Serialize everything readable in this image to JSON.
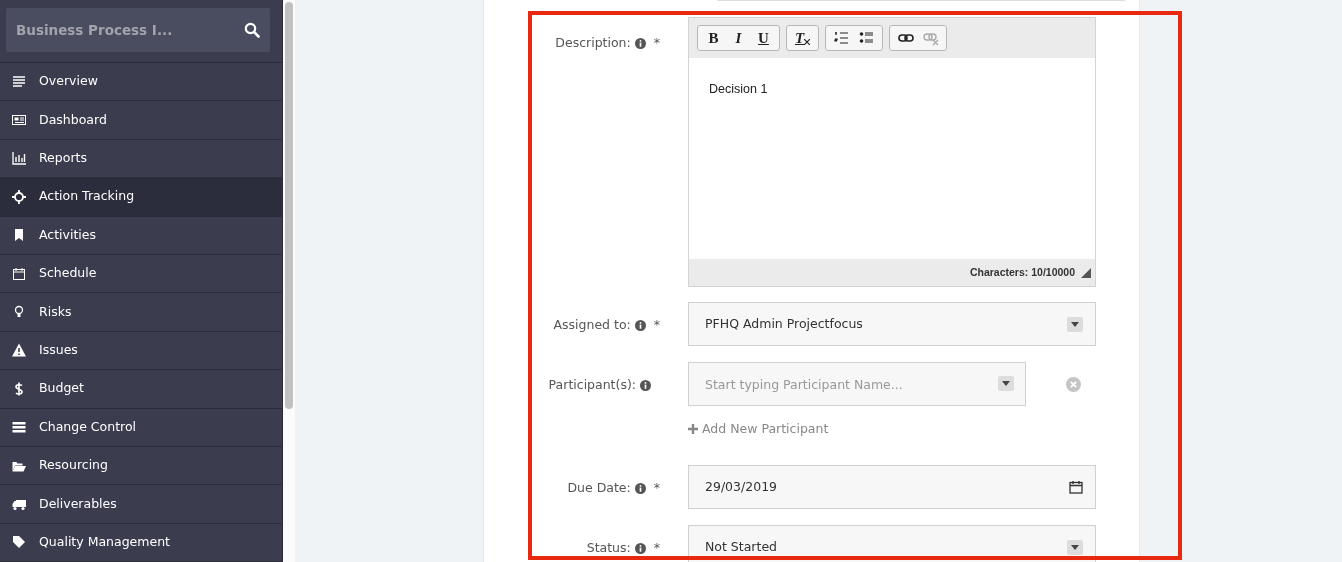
{
  "sidebar": {
    "search": {
      "value": "Business Process I..."
    },
    "items": [
      {
        "label": "Overview",
        "selected": false
      },
      {
        "label": "Dashboard",
        "selected": false
      },
      {
        "label": "Reports",
        "selected": false
      },
      {
        "label": "Action Tracking",
        "selected": true
      },
      {
        "label": "Activities",
        "selected": false
      },
      {
        "label": "Schedule",
        "selected": false
      },
      {
        "label": "Risks",
        "selected": false
      },
      {
        "label": "Issues",
        "selected": false
      },
      {
        "label": "Budget",
        "selected": false
      },
      {
        "label": "Change Control",
        "selected": false
      },
      {
        "label": "Resourcing",
        "selected": false
      },
      {
        "label": "Deliverables",
        "selected": false
      },
      {
        "label": "Quality Management",
        "selected": false
      }
    ]
  },
  "form": {
    "fields": [
      {
        "kind": "editor",
        "label": "Description:",
        "required": "*",
        "toolbar": [
          [
            {
              "glyph": "B",
              "disabled": false
            },
            {
              "glyph": "I",
              "disabled": false
            },
            {
              "glyph": "U",
              "disabled": false
            }
          ],
          [
            {
              "glyph": "T",
              "disabled": false
            }
          ],
          [
            {
              "kind": "ordered",
              "disabled": false
            },
            {
              "kind": "bullets",
              "disabled": false
            }
          ],
          [
            {
              "kind": "link",
              "disabled": false
            },
            {
              "kind": "unlink",
              "disabled": true
            }
          ]
        ],
        "content": "Decision 1",
        "counter": "Characters: 10/10000"
      },
      {
        "kind": "select",
        "label": "Assigned to:",
        "required": "*",
        "value": "PFHQ Admin Projectfocus"
      },
      {
        "kind": "typeahead",
        "label": "Participant(s):",
        "placeholder": "Start typing Participant Name...",
        "add_link": "Add New Participant"
      },
      {
        "kind": "date",
        "label": "Due Date:",
        "required": "*",
        "value": "29/03/2019"
      },
      {
        "kind": "select",
        "label": "Status:",
        "required": "*",
        "value": "Not Started"
      }
    ]
  }
}
